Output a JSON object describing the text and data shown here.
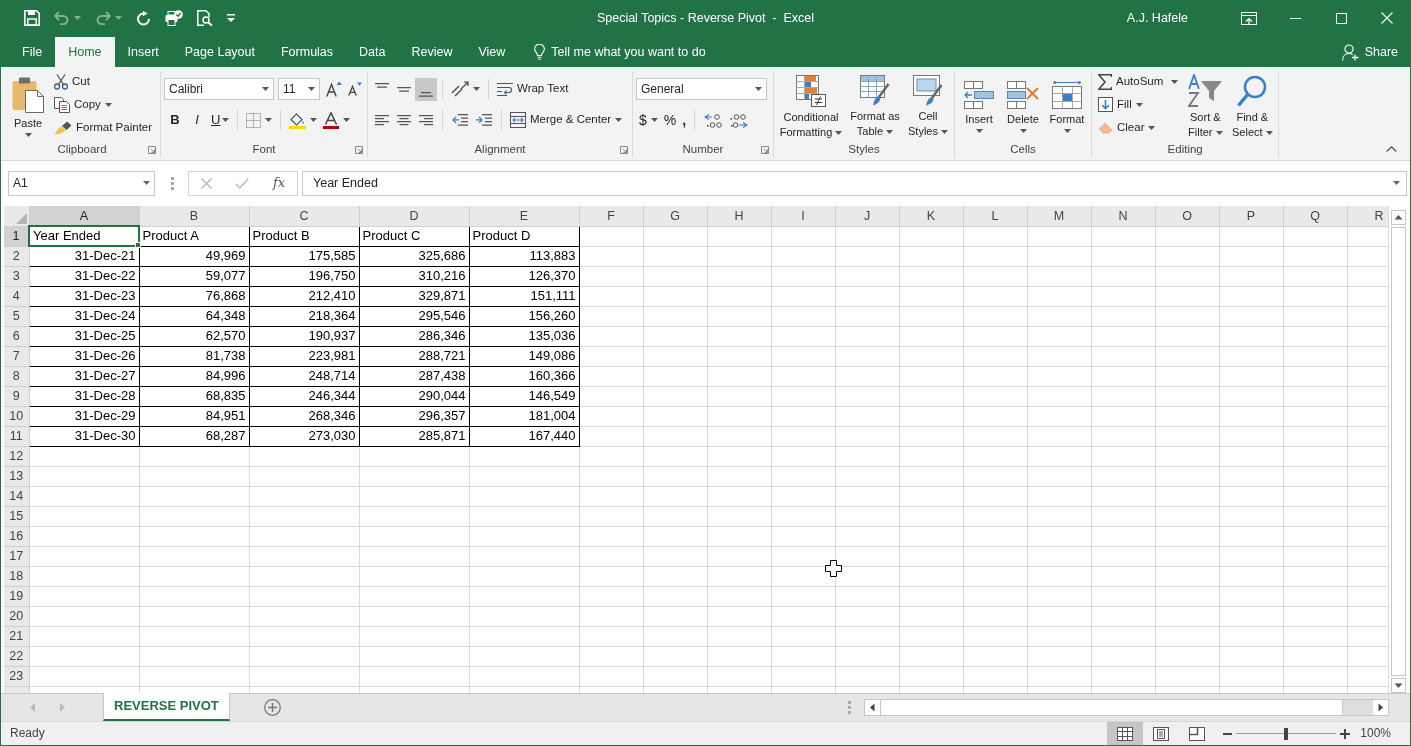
{
  "window": {
    "title": "Special Topics - Reverse Pivot  -  Excel",
    "user": "A.J. Hafele"
  },
  "quick_access": [
    {
      "kind": "save",
      "disabled": false
    },
    {
      "kind": "undo",
      "disabled": true
    },
    {
      "kind": "redo",
      "disabled": true
    },
    {
      "kind": "repeat",
      "disabled": false
    },
    {
      "kind": "touch",
      "disabled": false
    },
    {
      "kind": "preview",
      "disabled": false
    },
    {
      "kind": "customize",
      "disabled": false
    }
  ],
  "tabs": [
    {
      "label": "File",
      "selected": false
    },
    {
      "label": "Home",
      "selected": true
    },
    {
      "label": "Insert",
      "selected": false
    },
    {
      "label": "Page Layout",
      "selected": false
    },
    {
      "label": "Formulas",
      "selected": false
    },
    {
      "label": "Data",
      "selected": false
    },
    {
      "label": "Review",
      "selected": false
    },
    {
      "label": "View",
      "selected": false
    }
  ],
  "tell_me": "Tell me what you want to do",
  "share": "Share",
  "ribbon": {
    "clipboard": {
      "label": "Clipboard",
      "paste": "Paste",
      "cut": "Cut",
      "copy": "Copy",
      "format_painter": "Format Painter"
    },
    "font": {
      "label": "Font",
      "font_name": "Calibri",
      "font_size": "11",
      "bold": "B",
      "italic": "I",
      "underline": "U"
    },
    "alignment": {
      "label": "Alignment",
      "buttons": [
        {
          "kind": "top",
          "selected": false
        },
        {
          "kind": "middle",
          "selected": false
        },
        {
          "kind": "bottom",
          "selected": true
        },
        {
          "kind": "left",
          "selected": false
        },
        {
          "kind": "center",
          "selected": false
        },
        {
          "kind": "right",
          "selected": false
        }
      ],
      "wrap_text": "Wrap Text",
      "merge_center": "Merge & Center"
    },
    "number": {
      "label": "Number",
      "format": "General",
      "currency": "$",
      "percent": "%",
      "comma": ","
    },
    "styles": {
      "label": "Styles",
      "commands": [
        {
          "kind": "conditional",
          "label": "Conditional Formatting"
        },
        {
          "kind": "table",
          "label": "Format as Table"
        },
        {
          "kind": "cell_styles",
          "label": "Cell Styles"
        }
      ]
    },
    "cells": {
      "label": "Cells",
      "commands": [
        {
          "kind": "insert",
          "label": "Insert"
        },
        {
          "kind": "delete",
          "label": "Delete"
        },
        {
          "kind": "format",
          "label": "Format"
        }
      ]
    },
    "editing": {
      "label": "Editing",
      "autosum": "AutoSum",
      "fill": "Fill",
      "clear": "Clear",
      "sort_filter": "Sort & Filter",
      "find_select": "Find & Select"
    }
  },
  "formula_bar": {
    "name_box": "A1",
    "function_label": "fx",
    "formula": "Year Ended"
  },
  "sheet": {
    "column_headers": [
      {
        "label": "A",
        "selected": true
      },
      {
        "label": "B",
        "selected": false
      },
      {
        "label": "C",
        "selected": false
      },
      {
        "label": "D",
        "selected": false
      },
      {
        "label": "E",
        "selected": false
      },
      {
        "label": "F",
        "selected": false
      },
      {
        "label": "G",
        "selected": false
      },
      {
        "label": "H",
        "selected": false
      },
      {
        "label": "I",
        "selected": false
      },
      {
        "label": "J",
        "selected": false
      },
      {
        "label": "K",
        "selected": false
      },
      {
        "label": "L",
        "selected": false
      },
      {
        "label": "M",
        "selected": false
      },
      {
        "label": "N",
        "selected": false
      },
      {
        "label": "O",
        "selected": false
      },
      {
        "label": "P",
        "selected": false
      },
      {
        "label": "Q",
        "selected": false
      },
      {
        "label": "R",
        "selected": false
      }
    ],
    "row_headers": [
      {
        "label": "1",
        "selected": true
      },
      {
        "label": "2",
        "selected": false
      },
      {
        "label": "3",
        "selected": false
      },
      {
        "label": "4",
        "selected": false
      },
      {
        "label": "5",
        "selected": false
      },
      {
        "label": "6",
        "selected": false
      },
      {
        "label": "7",
        "selected": false
      },
      {
        "label": "8",
        "selected": false
      },
      {
        "label": "9",
        "selected": false
      },
      {
        "label": "10",
        "selected": false
      },
      {
        "label": "11",
        "selected": false
      },
      {
        "label": "12",
        "selected": false
      },
      {
        "label": "13",
        "selected": false
      },
      {
        "label": "14",
        "selected": false
      },
      {
        "label": "15",
        "selected": false
      },
      {
        "label": "16",
        "selected": false
      },
      {
        "label": "17",
        "selected": false
      },
      {
        "label": "18",
        "selected": false
      },
      {
        "label": "19",
        "selected": false
      },
      {
        "label": "20",
        "selected": false
      },
      {
        "label": "21",
        "selected": false
      },
      {
        "label": "22",
        "selected": false
      },
      {
        "label": "23",
        "selected": false
      }
    ],
    "table": {
      "columns": [
        {
          "label": "Year Ended",
          "selected": true
        },
        {
          "label": "Product A",
          "selected": false
        },
        {
          "label": "Product B",
          "selected": false
        },
        {
          "label": "Product C",
          "selected": false
        },
        {
          "label": "Product D",
          "selected": false
        }
      ],
      "rows": [
        [
          "31-Dec-21",
          "49,969",
          "175,585",
          "325,686",
          "113,883"
        ],
        [
          "31-Dec-22",
          "59,077",
          "196,750",
          "310,216",
          "126,370"
        ],
        [
          "31-Dec-23",
          "76,868",
          "212,410",
          "329,871",
          "151,111"
        ],
        [
          "31-Dec-24",
          "64,348",
          "218,364",
          "295,546",
          "156,260"
        ],
        [
          "31-Dec-25",
          "62,570",
          "190,937",
          "286,346",
          "135,036"
        ],
        [
          "31-Dec-26",
          "81,738",
          "223,981",
          "288,721",
          "149,086"
        ],
        [
          "31-Dec-27",
          "84,996",
          "248,714",
          "287,438",
          "160,366"
        ],
        [
          "31-Dec-28",
          "68,835",
          "246,344",
          "290,044",
          "146,549"
        ],
        [
          "31-Dec-29",
          "84,951",
          "268,346",
          "296,357",
          "181,004"
        ],
        [
          "31-Dec-30",
          "68,287",
          "273,030",
          "285,871",
          "167,440"
        ]
      ]
    }
  },
  "sheet_tabs": [
    {
      "label": "REVERSE PIVOT",
      "selected": true
    }
  ],
  "status_bar": {
    "status": "Ready",
    "views": [
      {
        "kind": "normal",
        "selected": true
      },
      {
        "kind": "page_layout",
        "selected": false
      },
      {
        "kind": "page_break",
        "selected": false
      }
    ],
    "zoom": {
      "level": 0.5,
      "reading": "100%"
    }
  }
}
